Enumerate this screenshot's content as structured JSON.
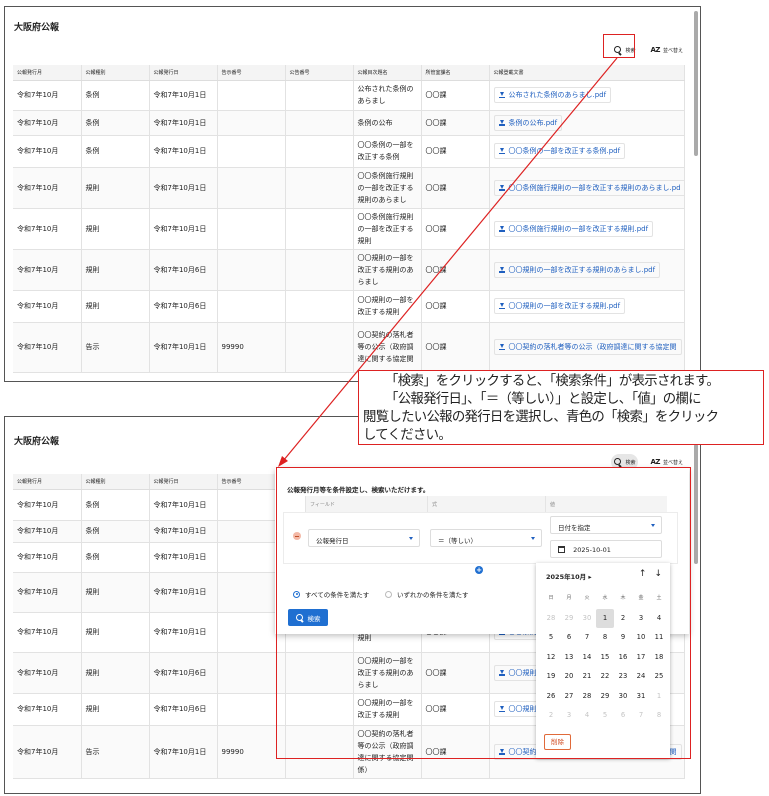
{
  "title": "大阪府公報",
  "toolbar": {
    "search_label": "検索",
    "sort_label": "並べ替え",
    "sort_icon": "AZ"
  },
  "table": {
    "headers": [
      "公報発行月",
      "公報種別",
      "公報発行日",
      "告示番号",
      "公告番号",
      "公報目次題名",
      "所管室課名",
      "公報登載文書"
    ],
    "rows": [
      {
        "month": "令和7年10月",
        "type": "条例",
        "date": "令和7年10月1日",
        "notice_no": "",
        "pub_no": "",
        "subject": "公布された条例のあらまし",
        "dept": "〇〇課",
        "doc": "公布された条例のあらまし.pdf"
      },
      {
        "month": "令和7年10月",
        "type": "条例",
        "date": "令和7年10月1日",
        "notice_no": "",
        "pub_no": "",
        "subject": "条例の公布",
        "dept": "〇〇課",
        "doc": "条例の公布.pdf"
      },
      {
        "month": "令和7年10月",
        "type": "条例",
        "date": "令和7年10月1日",
        "notice_no": "",
        "pub_no": "",
        "subject": "〇〇条例の一部を改正する条例",
        "dept": "〇〇課",
        "doc": "〇〇条例の一部を改正する条例.pdf"
      },
      {
        "month": "令和7年10月",
        "type": "規則",
        "date": "令和7年10月1日",
        "notice_no": "",
        "pub_no": "",
        "subject": "〇〇条例施行規則の一部を改正する規則のあらまし",
        "dept": "〇〇課",
        "doc": "〇〇条例施行規則の一部を改正する規則のあらまし.pd"
      },
      {
        "month": "令和7年10月",
        "type": "規則",
        "date": "令和7年10月1日",
        "notice_no": "",
        "pub_no": "",
        "subject": "〇〇条例施行規則の一部を改正する規則",
        "dept": "〇〇課",
        "doc": "〇〇条例施行規則の一部を改正する規則.pdf"
      },
      {
        "month": "令和7年10月",
        "type": "規則",
        "date": "令和7年10月6日",
        "notice_no": "",
        "pub_no": "",
        "subject": "〇〇規則の一部を改正する規則のあらまし",
        "dept": "〇〇課",
        "doc": "〇〇規則の一部を改正する規則のあらまし.pdf"
      },
      {
        "month": "令和7年10月",
        "type": "規則",
        "date": "令和7年10月6日",
        "notice_no": "",
        "pub_no": "",
        "subject": "〇〇規則の一部を改正する規則",
        "dept": "〇〇課",
        "doc": "〇〇規則の一部を改正する規則.pdf"
      },
      {
        "month": "令和7年10月",
        "type": "告示",
        "date": "令和7年10月1日",
        "notice_no": "99990",
        "pub_no": "",
        "subject": "〇〇契約の落札者等の公示（政府調達に関する協定関",
        "dept": "〇〇課",
        "doc": "〇〇契約の落札者等の公示（政府調達に関する協定関"
      }
    ]
  },
  "table2_rows": [
    {
      "month": "令和7年10月",
      "type": "条例",
      "date": "令和7年10月1日",
      "subject": "",
      "dept": "",
      "doc": ""
    },
    {
      "month": "令和7年10月",
      "type": "条例",
      "date": "令和7年10月1日",
      "subject": "",
      "dept": "",
      "doc": ""
    },
    {
      "month": "令和7年10月",
      "type": "条例",
      "date": "令和7年10月1日",
      "subject": "",
      "dept": "",
      "doc": ""
    },
    {
      "month": "令和7年10月",
      "type": "規則",
      "date": "令和7年10月1日",
      "subject": "",
      "dept": "",
      "doc": ""
    },
    {
      "month": "令和7年10月",
      "type": "規則",
      "date": "令和7年10月1日",
      "subject": "の一部を改正する規則",
      "dept": "〇〇課",
      "doc": "〇〇条例"
    },
    {
      "month": "令和7年10月",
      "type": "規則",
      "date": "令和7年10月6日",
      "subject": "〇〇規則の一部を改正する規則のあらまし",
      "dept": "〇〇課",
      "doc": "〇〇規則"
    },
    {
      "month": "令和7年10月",
      "type": "規則",
      "date": "令和7年10月6日",
      "subject": "〇〇規則の一部を改正する規則",
      "dept": "〇〇課",
      "doc": "〇〇規則"
    },
    {
      "month": "令和7年10月",
      "type": "告示",
      "date": "令和7年10月1日",
      "notice_no": "99990",
      "subject": "〇〇契約の落札者等の公示（政府調達に関する協定関係）",
      "dept": "〇〇課",
      "doc": "〇〇契約の落札者等の公示（政府調達に関する協定関"
    }
  ],
  "callout": {
    "lines": [
      "「検索」をクリックすると、「検索条件」が表示されます。",
      "「公報発行日」、「＝（等しい）」と設定し、「値」の欄に",
      "閲覧したい公報の発行日を選択し、青色の「検索」をクリック",
      "してください。"
    ]
  },
  "search_panel": {
    "title": "公報発行月等を条件設定し、検索いただけます。",
    "field_header": "フィールド",
    "op_header": "式",
    "value_header": "値",
    "field_value": "公報発行日",
    "op_value": "＝（等しい）",
    "value_mode": "日付を指定",
    "date_value": "2025-10-01",
    "match_all": "すべての条件を満たす",
    "match_any": "いずれかの条件を満たす",
    "search_button": "検索"
  },
  "datepicker": {
    "month_label": "2025年10月",
    "weekdays": [
      "日",
      "月",
      "火",
      "水",
      "木",
      "金",
      "土"
    ],
    "days": [
      [
        "28",
        "29",
        "30",
        "1",
        "2",
        "3",
        "4"
      ],
      [
        "5",
        "6",
        "7",
        "8",
        "9",
        "10",
        "11"
      ],
      [
        "12",
        "13",
        "14",
        "15",
        "16",
        "17",
        "18"
      ],
      [
        "19",
        "20",
        "21",
        "22",
        "23",
        "24",
        "25"
      ],
      [
        "26",
        "27",
        "28",
        "29",
        "30",
        "31",
        "1"
      ],
      [
        "2",
        "3",
        "4",
        "5",
        "6",
        "7",
        "8"
      ]
    ],
    "selected": "1",
    "clear_label": "削除"
  },
  "colors": {
    "accent": "#1f6fd1",
    "annotation": "#dd2222",
    "link": "#1f5fbf"
  }
}
